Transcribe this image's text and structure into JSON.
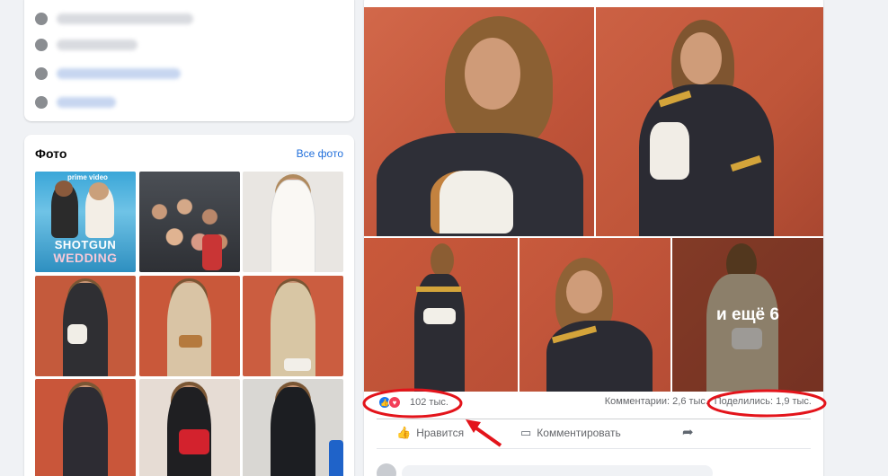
{
  "profile_info": {
    "rows": [
      {
        "icon": "info-icon"
      },
      {
        "icon": "phone-icon"
      },
      {
        "icon": "globe-icon"
      },
      {
        "icon": "globe-icon"
      }
    ]
  },
  "photos": {
    "title": "Фото",
    "see_all_link": "Все фото",
    "tiles": [
      {
        "kind": "poster",
        "brand": "prime video",
        "line1": "SHOTGUN",
        "line2": "WEDDING"
      },
      {
        "kind": "crowd"
      },
      {
        "kind": "white-suit"
      },
      {
        "kind": "red-wall"
      },
      {
        "kind": "red-wall-trench"
      },
      {
        "kind": "red-wall-trench"
      },
      {
        "kind": "red-wall-pose"
      },
      {
        "kind": "red-bag"
      },
      {
        "kind": "leather-jacket"
      }
    ]
  },
  "post": {
    "more_label": "и ещё 6",
    "reactions": {
      "icons": [
        "like-icon",
        "love-icon"
      ],
      "count": "102 тыс."
    },
    "comments": "Комментарии: 2,6 тыс.",
    "shares": "Поделились: 1,9 тыс.",
    "actions": {
      "like": "Нравится",
      "comment": "Комментировать"
    }
  },
  "colors": {
    "accent_link": "#216fdb",
    "annotation_red": "#e3141b",
    "wall_orange": "#c9583a"
  }
}
